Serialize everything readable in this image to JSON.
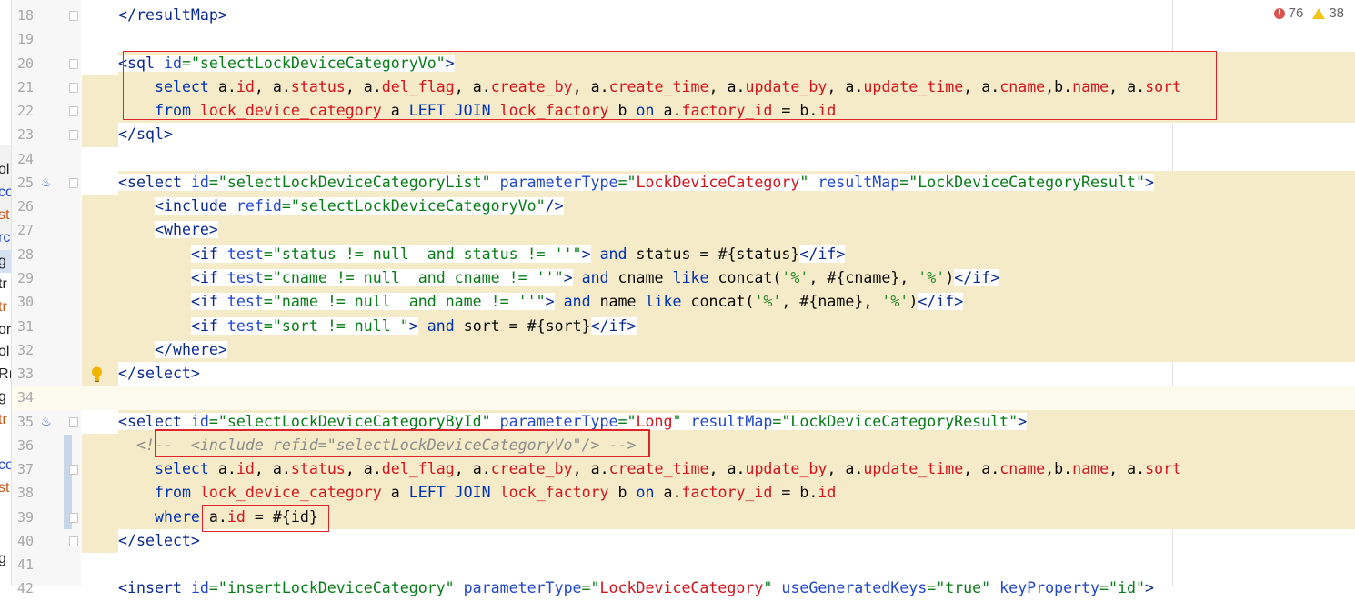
{
  "colors": {
    "injection_bg": "#f5ebc8",
    "current_line_bg": "#fdfaee",
    "annotation_box": "#e0242c"
  },
  "inspection": {
    "errors": "76",
    "warnings": "38",
    "error_icon": "error-circle-icon",
    "warning_icon": "warning-triangle-icon"
  },
  "sidebar": {
    "items": [
      {
        "text": "ol",
        "color": "#222222"
      },
      {
        "text": "co",
        "color": "#2148c9"
      },
      {
        "text": "st",
        "color": "#c25b1c"
      },
      {
        "text": "rc",
        "color": "#2148c9"
      },
      {
        "text": "g",
        "color": "#222222",
        "selected": true
      },
      {
        "text": "tr",
        "color": "#222222"
      },
      {
        "text": "tr",
        "color": "#c25b1c"
      },
      {
        "text": "or",
        "color": "#222222"
      },
      {
        "text": "ol",
        "color": "#222222"
      },
      {
        "text": "Rı",
        "color": "#222222"
      },
      {
        "text": "g",
        "color": "#222222"
      },
      {
        "text": "tr",
        "color": "#c25b1c"
      },
      {
        "text": "co",
        "color": "#2148c9"
      },
      {
        "text": "st",
        "color": "#c25b1c"
      },
      {
        "text": "g",
        "color": "#222222"
      }
    ]
  },
  "editor": {
    "lines": [
      {
        "num": "18",
        "type": "plain",
        "tokens": [
          [
            "t",
            "</resultMap>"
          ]
        ]
      },
      {
        "num": "19",
        "type": "plain",
        "tokens": []
      },
      {
        "num": "20",
        "type": "open",
        "tokens": [
          [
            "t",
            "<sql"
          ],
          [
            "ts",
            " "
          ],
          [
            "a",
            "id"
          ],
          [
            "v",
            "=\"selectLockDeviceCategoryVo\""
          ],
          [
            "t",
            ">"
          ]
        ]
      },
      {
        "num": "21",
        "type": "body",
        "tokens": [
          [
            "p",
            "    "
          ],
          [
            "k",
            "select"
          ],
          [
            "p",
            " a."
          ],
          [
            "i",
            "id"
          ],
          [
            "p",
            ", a."
          ],
          [
            "i",
            "status"
          ],
          [
            "p",
            ", a."
          ],
          [
            "i",
            "del_flag"
          ],
          [
            "p",
            ", a."
          ],
          [
            "i",
            "create_by"
          ],
          [
            "p",
            ", a."
          ],
          [
            "i",
            "create_time"
          ],
          [
            "p",
            ", a."
          ],
          [
            "i",
            "update_by"
          ],
          [
            "p",
            ", a."
          ],
          [
            "i",
            "update_time"
          ],
          [
            "p",
            ", a."
          ],
          [
            "i",
            "cname"
          ],
          [
            "p",
            ",b."
          ],
          [
            "i",
            "name"
          ],
          [
            "p",
            ", a."
          ],
          [
            "i",
            "sort"
          ]
        ]
      },
      {
        "num": "22",
        "type": "body",
        "tokens": [
          [
            "p",
            "    "
          ],
          [
            "k",
            "from"
          ],
          [
            "p",
            " "
          ],
          [
            "i",
            "lock_device_category"
          ],
          [
            "p",
            " a "
          ],
          [
            "k",
            "LEFT JOIN"
          ],
          [
            "p",
            " "
          ],
          [
            "i",
            "lock_factory"
          ],
          [
            "p",
            " b "
          ],
          [
            "k",
            "on"
          ],
          [
            "p",
            " a."
          ],
          [
            "i",
            "factory_id"
          ],
          [
            "p",
            " = b."
          ],
          [
            "i",
            "id"
          ]
        ]
      },
      {
        "num": "23",
        "type": "close",
        "tokens": [
          [
            "t",
            "</sql>"
          ]
        ]
      },
      {
        "num": "24",
        "type": "plain",
        "tokens": []
      },
      {
        "num": "25",
        "type": "open",
        "icon": "java-bean-icon",
        "tokens": [
          [
            "t",
            "<select"
          ],
          [
            "ts",
            " "
          ],
          [
            "a",
            "id"
          ],
          [
            "v",
            "=\"selectLockDeviceCategoryList\""
          ],
          [
            "ts",
            " "
          ],
          [
            "a",
            "parameterType"
          ],
          [
            "v",
            "=\""
          ],
          [
            "r",
            "LockDeviceCategory"
          ],
          [
            "v",
            "\""
          ],
          [
            "ts",
            " "
          ],
          [
            "a",
            "resultMap"
          ],
          [
            "v",
            "=\"LockDeviceCategoryResult\""
          ],
          [
            "t",
            ">"
          ]
        ]
      },
      {
        "num": "26",
        "type": "body",
        "tokens": [
          [
            "p",
            "    "
          ],
          [
            "t",
            "<include"
          ],
          [
            "ts",
            " "
          ],
          [
            "a",
            "refid"
          ],
          [
            "v",
            "=\"selectLockDeviceCategoryVo\""
          ],
          [
            "t",
            "/>"
          ]
        ]
      },
      {
        "num": "27",
        "type": "body",
        "tokens": [
          [
            "p",
            "    "
          ],
          [
            "t",
            "<where>"
          ]
        ]
      },
      {
        "num": "28",
        "type": "body",
        "tokens": [
          [
            "p",
            "        "
          ],
          [
            "t",
            "<if"
          ],
          [
            "ts",
            " "
          ],
          [
            "a",
            "test"
          ],
          [
            "v",
            "=\"status != null  and status != ''\""
          ],
          [
            "t",
            ">"
          ],
          [
            "p",
            " "
          ],
          [
            "k",
            "and"
          ],
          [
            "p",
            " status = #{status}"
          ],
          [
            "t",
            "</if>"
          ]
        ]
      },
      {
        "num": "29",
        "type": "body",
        "tokens": [
          [
            "p",
            "        "
          ],
          [
            "t",
            "<if"
          ],
          [
            "ts",
            " "
          ],
          [
            "a",
            "test"
          ],
          [
            "v",
            "=\"cname != null  and cname != ''\""
          ],
          [
            "t",
            ">"
          ],
          [
            "p",
            " "
          ],
          [
            "k",
            "and"
          ],
          [
            "p",
            " cname "
          ],
          [
            "k",
            "like"
          ],
          [
            "p",
            " concat("
          ],
          [
            "s",
            "'%'"
          ],
          [
            "p",
            ", #{cname}, "
          ],
          [
            "s",
            "'%'"
          ],
          [
            "p",
            ")"
          ],
          [
            "t",
            "</if>"
          ]
        ]
      },
      {
        "num": "30",
        "type": "body",
        "tokens": [
          [
            "p",
            "        "
          ],
          [
            "t",
            "<if"
          ],
          [
            "ts",
            " "
          ],
          [
            "a",
            "test"
          ],
          [
            "v",
            "=\"name != null  and name != ''\""
          ],
          [
            "t",
            ">"
          ],
          [
            "p",
            " "
          ],
          [
            "k",
            "and"
          ],
          [
            "p",
            " name "
          ],
          [
            "k",
            "like"
          ],
          [
            "p",
            " concat("
          ],
          [
            "s",
            "'%'"
          ],
          [
            "p",
            ", #{name}, "
          ],
          [
            "s",
            "'%'"
          ],
          [
            "p",
            ")"
          ],
          [
            "t",
            "</if>"
          ]
        ]
      },
      {
        "num": "31",
        "type": "body",
        "tokens": [
          [
            "p",
            "        "
          ],
          [
            "t",
            "<if"
          ],
          [
            "ts",
            " "
          ],
          [
            "a",
            "test"
          ],
          [
            "v",
            "=\"sort != null \""
          ],
          [
            "t",
            ">"
          ],
          [
            "p",
            " "
          ],
          [
            "k",
            "and"
          ],
          [
            "p",
            " sort = #{sort}"
          ],
          [
            "t",
            "</if>"
          ]
        ]
      },
      {
        "num": "32",
        "type": "body",
        "tokens": [
          [
            "p",
            "    "
          ],
          [
            "t",
            "</where>"
          ]
        ]
      },
      {
        "num": "33",
        "type": "close",
        "icon": "lightbulb-icon",
        "tokens": [
          [
            "t",
            "</select>"
          ]
        ]
      },
      {
        "num": "34",
        "type": "current",
        "tokens": []
      },
      {
        "num": "35",
        "type": "open",
        "icon": "java-bean-icon",
        "tokens": [
          [
            "t",
            "<select"
          ],
          [
            "ts",
            " "
          ],
          [
            "a",
            "id"
          ],
          [
            "v",
            "=\"selectLockDeviceCategoryById\""
          ],
          [
            "ts",
            " "
          ],
          [
            "a",
            "parameterType"
          ],
          [
            "v",
            "=\""
          ],
          [
            "r",
            "Long"
          ],
          [
            "v",
            "\""
          ],
          [
            "ts",
            " "
          ],
          [
            "a",
            "resultMap"
          ],
          [
            "v",
            "=\"LockDeviceCategoryResult\""
          ],
          [
            "t",
            ">"
          ]
        ]
      },
      {
        "num": "36",
        "type": "body",
        "tokens": [
          [
            "p",
            "  "
          ],
          [
            "c",
            "<!--  <include refid=\"selectLockDeviceCategoryVo\"/> -->"
          ]
        ]
      },
      {
        "num": "37",
        "type": "body",
        "tokens": [
          [
            "p",
            "    "
          ],
          [
            "k",
            "select"
          ],
          [
            "p",
            " a."
          ],
          [
            "i",
            "id"
          ],
          [
            "p",
            ", a."
          ],
          [
            "i",
            "status"
          ],
          [
            "p",
            ", a."
          ],
          [
            "i",
            "del_flag"
          ],
          [
            "p",
            ", a."
          ],
          [
            "i",
            "create_by"
          ],
          [
            "p",
            ", a."
          ],
          [
            "i",
            "create_time"
          ],
          [
            "p",
            ", a."
          ],
          [
            "i",
            "update_by"
          ],
          [
            "p",
            ", a."
          ],
          [
            "i",
            "update_time"
          ],
          [
            "p",
            ", a."
          ],
          [
            "i",
            "cname"
          ],
          [
            "p",
            ",b."
          ],
          [
            "i",
            "name"
          ],
          [
            "p",
            ", a."
          ],
          [
            "i",
            "sort"
          ]
        ]
      },
      {
        "num": "38",
        "type": "body",
        "tokens": [
          [
            "p",
            "    "
          ],
          [
            "k",
            "from"
          ],
          [
            "p",
            " "
          ],
          [
            "i",
            "lock_device_category"
          ],
          [
            "p",
            " a "
          ],
          [
            "k",
            "LEFT JOIN"
          ],
          [
            "p",
            " "
          ],
          [
            "i",
            "lock_factory"
          ],
          [
            "p",
            " b "
          ],
          [
            "k",
            "on"
          ],
          [
            "p",
            " a."
          ],
          [
            "i",
            "factory_id"
          ],
          [
            "p",
            " = b."
          ],
          [
            "i",
            "id"
          ]
        ]
      },
      {
        "num": "39",
        "type": "body",
        "tokens": [
          [
            "p",
            "    "
          ],
          [
            "k",
            "where"
          ],
          [
            "p",
            " a."
          ],
          [
            "i",
            "id"
          ],
          [
            "p",
            " = #{id}"
          ]
        ]
      },
      {
        "num": "40",
        "type": "close",
        "tokens": [
          [
            "t",
            "</select>"
          ]
        ]
      },
      {
        "num": "41",
        "type": "plain",
        "tokens": []
      },
      {
        "num": "42",
        "type": "plain",
        "tokens": [
          [
            "t",
            "<insert"
          ],
          [
            "ts",
            " "
          ],
          [
            "a",
            "id"
          ],
          [
            "v",
            "=\"insertLockDeviceCategory\""
          ],
          [
            "ts",
            " "
          ],
          [
            "a",
            "parameterType"
          ],
          [
            "v",
            "=\""
          ],
          [
            "r",
            "LockDeviceCategory"
          ],
          [
            "v",
            "\""
          ],
          [
            "ts",
            " "
          ],
          [
            "a",
            "useGeneratedKeys"
          ],
          [
            "v",
            "=\"true\""
          ],
          [
            "ts",
            " "
          ],
          [
            "a",
            "keyProperty"
          ],
          [
            "v",
            "=\"id\""
          ],
          [
            "t",
            ">"
          ]
        ]
      }
    ]
  }
}
